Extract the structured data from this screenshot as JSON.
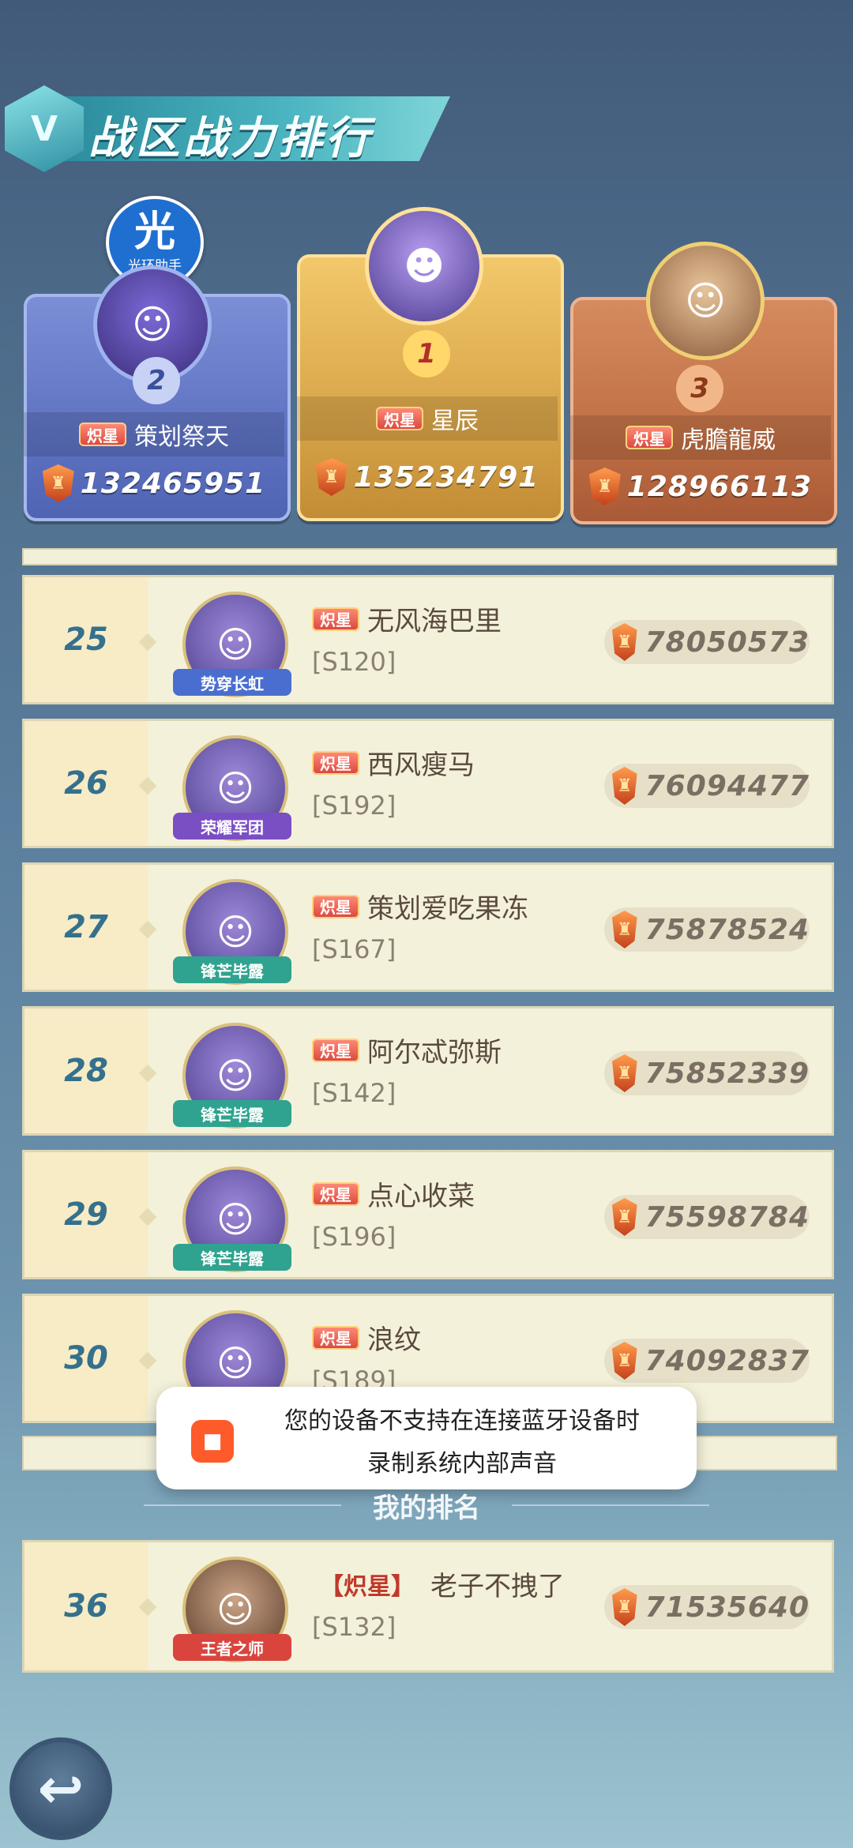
{
  "banner": {
    "title": "战区战力排行"
  },
  "assistant_badge": {
    "glyph": "光",
    "label": "光环助手"
  },
  "podium": {
    "first": {
      "rank": "1",
      "name": "星辰",
      "power": "135234791",
      "title_badge": "炽星"
    },
    "second": {
      "rank": "2",
      "name": "策划祭天",
      "power": "132465951",
      "title_badge": "炽星"
    },
    "third": {
      "rank": "3",
      "name": "虎膽龍威",
      "power": "128966113",
      "title_badge": "炽星"
    }
  },
  "list": [
    {
      "rank": "25",
      "name": "无风海巴里",
      "server": "[S120]",
      "power": "78050573",
      "hero_plate": "势穿长虹",
      "title_badge": "炽星",
      "plate_color": "#4a6ed0"
    },
    {
      "rank": "26",
      "name": "西风瘦马",
      "server": "[S192]",
      "power": "76094477",
      "hero_plate": "荣耀军团",
      "title_badge": "炽星",
      "plate_color": "#7a4fc4"
    },
    {
      "rank": "27",
      "name": "策划爱吃果冻",
      "server": "[S167]",
      "power": "75878524",
      "hero_plate": "锋芒毕露",
      "title_badge": "炽星",
      "plate_color": "#2fa38f"
    },
    {
      "rank": "28",
      "name": "阿尔忒弥斯",
      "server": "[S142]",
      "power": "75852339",
      "hero_plate": "锋芒毕露",
      "title_badge": "炽星",
      "plate_color": "#2fa38f"
    },
    {
      "rank": "29",
      "name": "点心收菜",
      "server": "[S196]",
      "power": "75598784",
      "hero_plate": "锋芒毕露",
      "title_badge": "炽星",
      "plate_color": "#2fa38f"
    },
    {
      "rank": "30",
      "name": "浪纹",
      "server": "[S189]",
      "power": "74092837",
      "hero_plate": "",
      "title_badge": "炽星",
      "plate_color": "#7a4fc4"
    }
  ],
  "toast": {
    "line1": "您的设备不支持在连接蓝牙设备时",
    "line2": "录制系统内部声音",
    "icon": "video-camera-icon"
  },
  "my_rank": {
    "header": "我的排名",
    "rank": "36",
    "name": "老子不拽了",
    "server": "[S132]",
    "power": "71535640",
    "hero_plate": "王者之师",
    "title_badge": "【炽星】",
    "plate_color": "#d9453d"
  },
  "back_button": {
    "icon": "back-arrow-icon",
    "glyph": "↩"
  },
  "colors": {
    "accent": "#35708d",
    "row_bg": "#f4f1da",
    "gold": "#e8c868"
  }
}
